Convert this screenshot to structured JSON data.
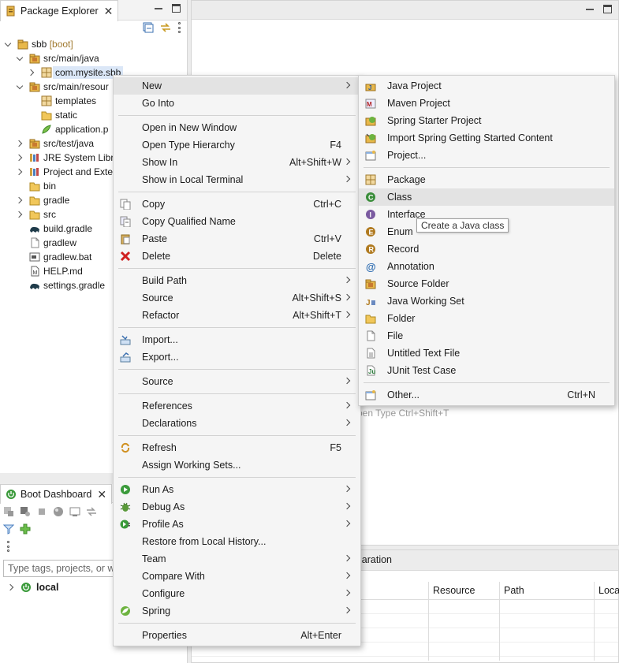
{
  "package_explorer": {
    "tab_label": "Package Explorer",
    "tree": [
      {
        "label": "sbb",
        "deco": " [boot]",
        "indent": 0,
        "twisty": "open",
        "icon": "project-icon"
      },
      {
        "label": "src/main/java",
        "indent": 1,
        "twisty": "open",
        "icon": "source-folder-icon"
      },
      {
        "label": "com.mysite.sbb",
        "indent": 2,
        "twisty": "closed",
        "icon": "package-icon",
        "selected": true
      },
      {
        "label": "src/main/resour",
        "indent": 1,
        "twisty": "open",
        "icon": "source-folder-icon"
      },
      {
        "label": "templates",
        "indent": 2,
        "twisty": "none",
        "icon": "package-icon"
      },
      {
        "label": "static",
        "indent": 2,
        "twisty": "none",
        "icon": "folder-icon"
      },
      {
        "label": "application.p",
        "indent": 2,
        "twisty": "none",
        "icon": "properties-icon"
      },
      {
        "label": "src/test/java",
        "indent": 1,
        "twisty": "closed",
        "icon": "source-folder-icon"
      },
      {
        "label": "JRE System Libra",
        "indent": 1,
        "twisty": "closed",
        "icon": "library-icon"
      },
      {
        "label": "Project and Exte",
        "indent": 1,
        "twisty": "closed",
        "icon": "library-icon"
      },
      {
        "label": "bin",
        "indent": 1,
        "twisty": "none",
        "icon": "folder-icon"
      },
      {
        "label": "gradle",
        "indent": 1,
        "twisty": "closed",
        "icon": "folder-icon"
      },
      {
        "label": "src",
        "indent": 1,
        "twisty": "closed",
        "icon": "folder-icon"
      },
      {
        "label": "build.gradle",
        "indent": 1,
        "twisty": "none",
        "icon": "gradle-icon"
      },
      {
        "label": "gradlew",
        "indent": 1,
        "twisty": "none",
        "icon": "file-icon"
      },
      {
        "label": "gradlew.bat",
        "indent": 1,
        "twisty": "none",
        "icon": "bat-file-icon"
      },
      {
        "label": "HELP.md",
        "indent": 1,
        "twisty": "none",
        "icon": "markdown-file-icon"
      },
      {
        "label": "settings.gradle",
        "indent": 1,
        "twisty": "none",
        "icon": "gradle-icon"
      }
    ]
  },
  "boot_dashboard": {
    "tab_label": "Boot Dashboard",
    "filter_placeholder": "Type tags, projects, or wo",
    "local_label": "local"
  },
  "editor": {
    "hint_text": "pen Type   Ctrl+Shift+T"
  },
  "bottom_panel": {
    "tab_label": "laration",
    "columns": [
      "Resource",
      "Path",
      "Loca"
    ]
  },
  "context_menu": {
    "items": [
      {
        "label": "New",
        "accel": "",
        "submenu": true,
        "icon": "",
        "highlighted": true
      },
      {
        "label": "Go Into",
        "accel": "",
        "submenu": false,
        "icon": ""
      },
      {
        "sep": true
      },
      {
        "label": "Open in New Window",
        "accel": "",
        "submenu": false,
        "icon": ""
      },
      {
        "label": "Open Type Hierarchy",
        "accel": "F4",
        "submenu": false,
        "icon": ""
      },
      {
        "label": "Show In",
        "accel": "Alt+Shift+W",
        "submenu": true,
        "icon": ""
      },
      {
        "label": "Show in Local Terminal",
        "accel": "",
        "submenu": true,
        "icon": ""
      },
      {
        "sep": true
      },
      {
        "label": "Copy",
        "accel": "Ctrl+C",
        "submenu": false,
        "icon": "copy-icon"
      },
      {
        "label": "Copy Qualified Name",
        "accel": "",
        "submenu": false,
        "icon": "copy-qualified-icon"
      },
      {
        "label": "Paste",
        "accel": "Ctrl+V",
        "submenu": false,
        "icon": "paste-icon"
      },
      {
        "label": "Delete",
        "accel": "Delete",
        "submenu": false,
        "icon": "delete-icon"
      },
      {
        "sep": true
      },
      {
        "label": "Build Path",
        "accel": "",
        "submenu": true,
        "icon": ""
      },
      {
        "label": "Source",
        "accel": "Alt+Shift+S",
        "submenu": true,
        "icon": ""
      },
      {
        "label": "Refactor",
        "accel": "Alt+Shift+T",
        "submenu": true,
        "icon": ""
      },
      {
        "sep": true
      },
      {
        "label": "Import...",
        "accel": "",
        "submenu": false,
        "icon": "import-icon"
      },
      {
        "label": "Export...",
        "accel": "",
        "submenu": false,
        "icon": "export-icon"
      },
      {
        "sep": true
      },
      {
        "label": "Source",
        "accel": "",
        "submenu": true,
        "icon": ""
      },
      {
        "sep": true
      },
      {
        "label": "References",
        "accel": "",
        "submenu": true,
        "icon": ""
      },
      {
        "label": "Declarations",
        "accel": "",
        "submenu": true,
        "icon": ""
      },
      {
        "sep": true
      },
      {
        "label": "Refresh",
        "accel": "F5",
        "submenu": false,
        "icon": "refresh-icon"
      },
      {
        "label": "Assign Working Sets...",
        "accel": "",
        "submenu": false,
        "icon": ""
      },
      {
        "sep": true
      },
      {
        "label": "Run As",
        "accel": "",
        "submenu": true,
        "icon": "run-icon"
      },
      {
        "label": "Debug As",
        "accel": "",
        "submenu": true,
        "icon": "debug-icon"
      },
      {
        "label": "Profile As",
        "accel": "",
        "submenu": true,
        "icon": "profile-icon"
      },
      {
        "label": "Restore from Local History...",
        "accel": "",
        "submenu": false,
        "icon": ""
      },
      {
        "label": "Team",
        "accel": "",
        "submenu": true,
        "icon": ""
      },
      {
        "label": "Compare With",
        "accel": "",
        "submenu": true,
        "icon": ""
      },
      {
        "label": "Configure",
        "accel": "",
        "submenu": true,
        "icon": ""
      },
      {
        "label": "Spring",
        "accel": "",
        "submenu": true,
        "icon": "spring-icon"
      },
      {
        "sep": true
      },
      {
        "label": "Properties",
        "accel": "Alt+Enter",
        "submenu": false,
        "icon": ""
      }
    ]
  },
  "new_submenu": {
    "items": [
      {
        "label": "Java Project",
        "accel": "",
        "icon": "java-project-icon"
      },
      {
        "label": "Maven Project",
        "accel": "",
        "icon": "maven-project-icon"
      },
      {
        "label": "Spring Starter Project",
        "accel": "",
        "icon": "spring-starter-icon"
      },
      {
        "label": "Import Spring Getting Started Content",
        "accel": "",
        "icon": "spring-import-icon"
      },
      {
        "label": "Project...",
        "accel": "",
        "icon": "project-wizard-icon"
      },
      {
        "sep": true
      },
      {
        "label": "Package",
        "accel": "",
        "icon": "package-icon"
      },
      {
        "label": "Class",
        "accel": "",
        "icon": "class-icon",
        "highlighted": true
      },
      {
        "label": "Interface",
        "accel": "",
        "icon": "interface-icon"
      },
      {
        "label": "Enum",
        "accel": "",
        "icon": "enum-icon"
      },
      {
        "label": "Record",
        "accel": "",
        "icon": "record-icon"
      },
      {
        "label": "Annotation",
        "accel": "",
        "icon": "annotation-icon"
      },
      {
        "label": "Source Folder",
        "accel": "",
        "icon": "source-folder-icon"
      },
      {
        "label": "Java Working Set",
        "accel": "",
        "icon": "working-set-icon"
      },
      {
        "label": "Folder",
        "accel": "",
        "icon": "folder-icon"
      },
      {
        "label": "File",
        "accel": "",
        "icon": "file-icon"
      },
      {
        "label": "Untitled Text File",
        "accel": "",
        "icon": "text-file-icon"
      },
      {
        "label": "JUnit Test Case",
        "accel": "",
        "icon": "junit-icon"
      },
      {
        "sep": true
      },
      {
        "label": "Other...",
        "accel": "Ctrl+N",
        "icon": "other-wizard-icon"
      }
    ]
  },
  "tooltip": {
    "text": "Create a Java class"
  },
  "colors": {
    "accent": "#dbe7f7",
    "folder": "#e8b84a",
    "java_green": "#3a8d3a",
    "spring_green": "#6db33f"
  }
}
